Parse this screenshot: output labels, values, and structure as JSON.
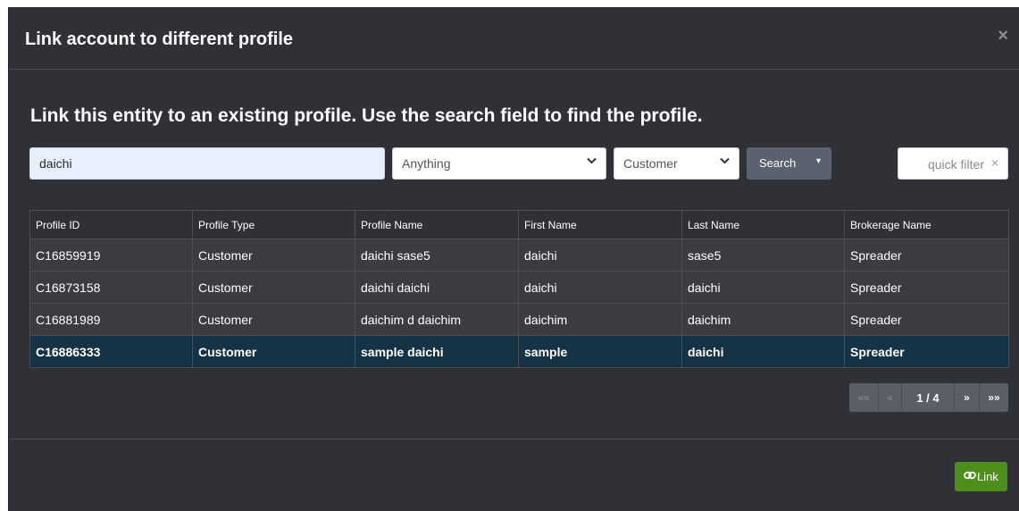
{
  "modal": {
    "title": "Link account to different profile",
    "close_glyph": "×"
  },
  "instruction": "Link this entity to an existing profile. Use the search field to find the profile.",
  "search": {
    "value": "daichi",
    "field_select": "Anything",
    "type_select": "Customer",
    "search_label": "Search",
    "caret_glyph": "▾",
    "chevron_glyph": "❯"
  },
  "quick_filter": {
    "placeholder": "quick filter",
    "clear_glyph": "×"
  },
  "table": {
    "columns": [
      "Profile ID",
      "Profile Type",
      "Profile Name",
      "First Name",
      "Last Name",
      "Brokerage Name"
    ],
    "rows": [
      [
        "C16859919",
        "Customer",
        "daichi sase5",
        "daichi",
        "sase5",
        "Spreader"
      ],
      [
        "C16873158",
        "Customer",
        "daichi daichi",
        "daichi",
        "daichi",
        "Spreader"
      ],
      [
        "C16881989",
        "Customer",
        "daichim d daichim",
        "daichim",
        "daichim",
        "Spreader"
      ],
      [
        "C16886333",
        "Customer",
        "sample daichi",
        "sample",
        "daichi",
        "Spreader"
      ]
    ],
    "selected_row": 3
  },
  "pager": {
    "first": "««",
    "prev": "«",
    "info": "1 / 4",
    "next": "»",
    "last": "»»"
  },
  "footer": {
    "link_label": "Link",
    "link_icon": "link-icon"
  },
  "colors": {
    "modal_bg": "#2f3136",
    "selected_row_bg": "#153345",
    "link_button_bg": "#4c8f1c",
    "search_button_bg": "#5a6270"
  }
}
